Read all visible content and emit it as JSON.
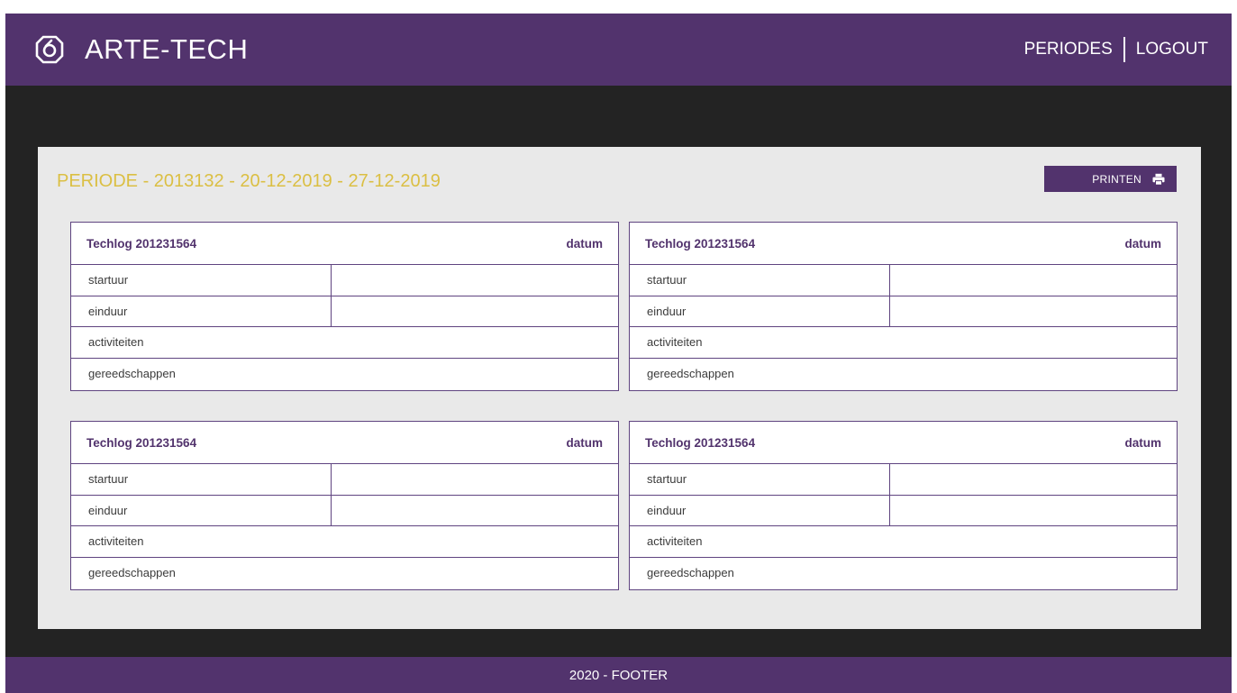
{
  "header": {
    "brand_icon": "arte-tech-logo-icon",
    "brand_name": "ARTE-TECH",
    "nav": {
      "periodes": "PERIODES",
      "logout": "LOGOUT"
    }
  },
  "panel": {
    "title": "PERIODE - 2013132 - 20-12-2019 - 27-12-2019",
    "print_label": "PRINTEN",
    "print_icon": "printer-icon"
  },
  "cards": [
    {
      "title": "Techlog 201231564",
      "date_label": "datum",
      "startuur": "startuur",
      "einduur": "einduur",
      "activiteiten": "activiteiten",
      "gereedschappen": "gereedschappen"
    },
    {
      "title": "Techlog 201231564",
      "date_label": "datum",
      "startuur": "startuur",
      "einduur": "einduur",
      "activiteiten": "activiteiten",
      "gereedschappen": "gereedschappen"
    },
    {
      "title": "Techlog 201231564",
      "date_label": "datum",
      "startuur": "startuur",
      "einduur": "einduur",
      "activiteiten": "activiteiten",
      "gereedschappen": "gereedschappen"
    },
    {
      "title": "Techlog 201231564",
      "date_label": "datum",
      "startuur": "startuur",
      "einduur": "einduur",
      "activiteiten": "activiteiten",
      "gereedschappen": "gereedschappen"
    }
  ],
  "footer": {
    "text": "2020 - FOOTER"
  },
  "colors": {
    "primary": "#52336d",
    "accent_title": "#dbbf43",
    "background": "#232323",
    "panel": "#e9e9e9"
  }
}
